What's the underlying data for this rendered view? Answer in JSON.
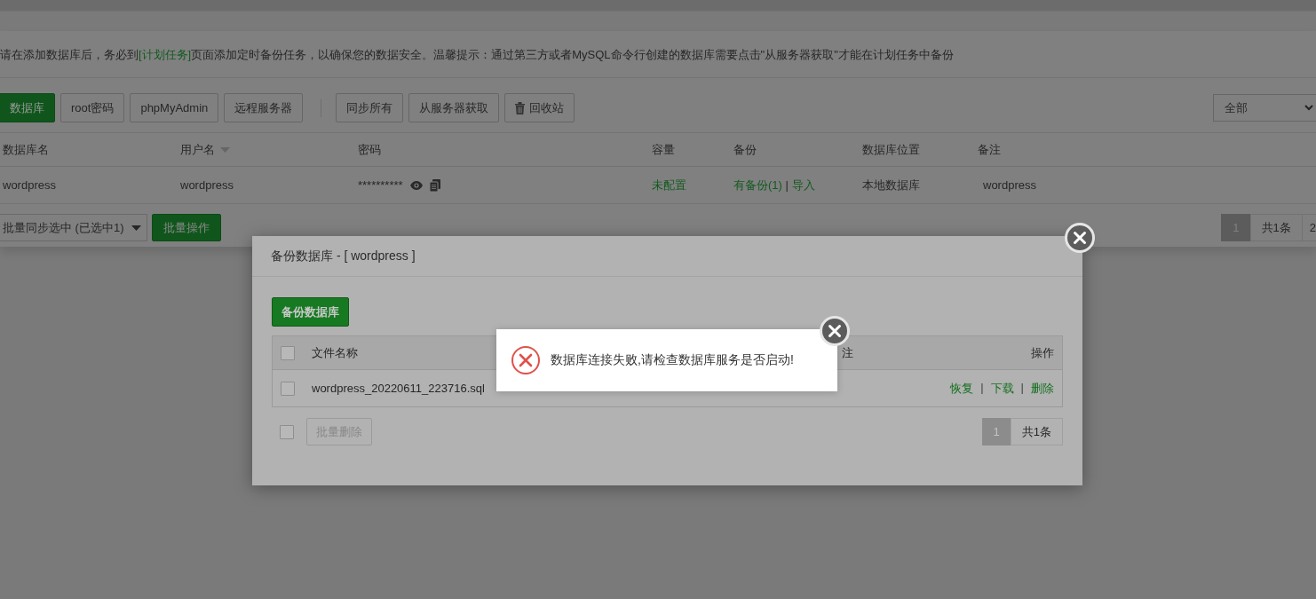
{
  "notice": {
    "before": "请在添加数据库后，务必到",
    "link": "[计划任务]",
    "after": "页面添加定时备份任务，以确保您的数据安全。温馨提示：通过第三方或者MySQL命令行创建的数据库需要点击\"从服务器获取\"才能在计划任务中备份"
  },
  "toolbar": {
    "left_buttons": [
      {
        "label": "数据库",
        "kind": "primary"
      },
      {
        "label": "root密码",
        "kind": "default"
      },
      {
        "label": "phpMyAdmin",
        "kind": "default"
      },
      {
        "label": "远程服务器",
        "kind": "default"
      }
    ],
    "right_buttons": [
      {
        "label": "同步所有",
        "kind": "default"
      },
      {
        "label": "从服务器获取",
        "kind": "default"
      },
      {
        "label": "回收站",
        "kind": "trash"
      }
    ],
    "filter": "全部"
  },
  "table": {
    "columns": [
      {
        "label": "数据库名",
        "sortable": false
      },
      {
        "label": "用户名",
        "sortable": true
      },
      {
        "label": "密码",
        "sortable": false
      },
      {
        "label": "容量",
        "sortable": false
      },
      {
        "label": "备份",
        "sortable": false
      },
      {
        "label": "数据库位置",
        "sortable": false
      },
      {
        "label": "备注",
        "sortable": false
      }
    ],
    "rows": [
      {
        "name": "wordpress",
        "user": "wordpress",
        "password": "**********",
        "capacity": "未配置",
        "backup": "有备份(1)",
        "separator": "|",
        "import": "导入",
        "location": "本地数据库",
        "note": "wordpress"
      }
    ]
  },
  "footer": {
    "batch_select": "批量同步选中 (已选中1)",
    "batch_button": "批量操作",
    "pages": [
      {
        "label": "1",
        "selected": true
      }
    ],
    "total": "共1条",
    "next": "2"
  },
  "modal": {
    "title": "备份数据库 - [ wordpress ]",
    "backup_button": "备份数据库",
    "header_checked": false,
    "columns": [
      {
        "label": "文件名称"
      },
      {
        "label": "注"
      },
      {
        "label": "操作"
      }
    ],
    "rows": [
      {
        "checked": false,
        "file": "wordpress_20220611_223716.sql",
        "actions": [
          {
            "kind": "link",
            "text": "恢复"
          },
          {
            "kind": "divider",
            "text": "|"
          },
          {
            "kind": "link",
            "text": "下载"
          },
          {
            "kind": "divider",
            "text": "|"
          },
          {
            "kind": "link",
            "text": "删除"
          }
        ]
      }
    ],
    "footer_checked": false,
    "delete_button": {
      "label": "批量删除",
      "disabled": true
    },
    "pages": [
      {
        "label": "1",
        "selected": true
      }
    ],
    "total": "共1条"
  },
  "toast": {
    "message": "数据库连接失败,请检查数据库服务是否启动!"
  }
}
